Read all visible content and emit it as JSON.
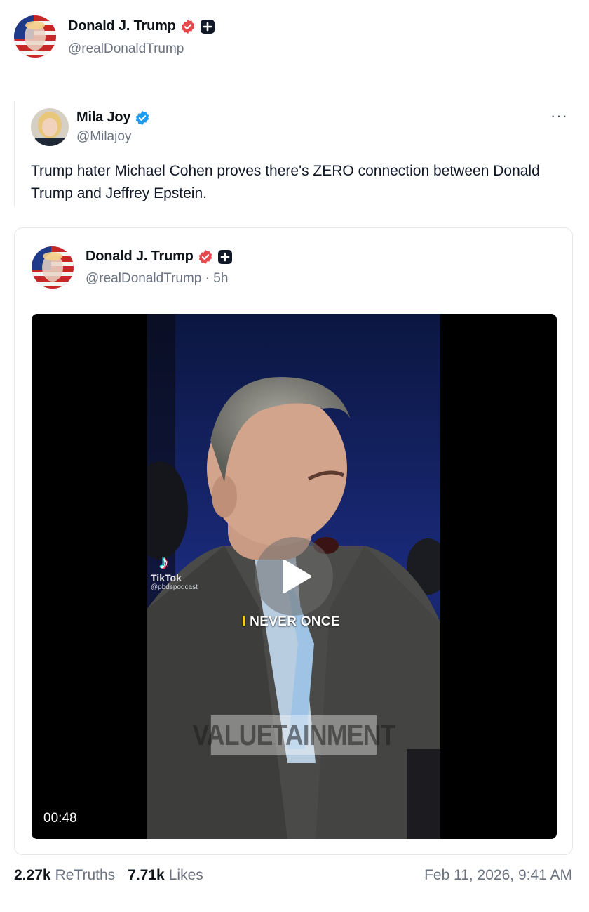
{
  "author": {
    "name": "Donald J. Trump",
    "handle": "@realDonaldTrump",
    "verified_icon": "verified-badge-icon",
    "extra_icon": "plus-square-icon",
    "verified_color": "#e8484d"
  },
  "quoted_post": {
    "name": "Mila Joy",
    "handle": "@Milajoy",
    "verified_color": "#1d9bf0",
    "more_label": "···",
    "text": "Trump hater Michael Cohen proves there's ZERO connection between Donald Trump and Jeffrey Epstein."
  },
  "embedded_post": {
    "name": "Donald J. Trump",
    "handle": "@realDonaldTrump",
    "separator": " · ",
    "age": "5h",
    "video": {
      "duration": "00:48",
      "caption_first": "I",
      "caption_rest": " NEVER ONCE",
      "caption_accent_color": "#facc15",
      "tiktok_logo": "♪",
      "tiktok_label": "TikTok",
      "tiktok_user": "@pbdspodcast",
      "watermark": "VALUETAINMENT",
      "play_icon": "play-icon"
    }
  },
  "stats": {
    "retruths_count": "2.27k",
    "retruths_label": "ReTruths",
    "likes_count": "7.71k",
    "likes_label": "Likes"
  },
  "timestamp": "Feb 11, 2026, 9:41 AM"
}
